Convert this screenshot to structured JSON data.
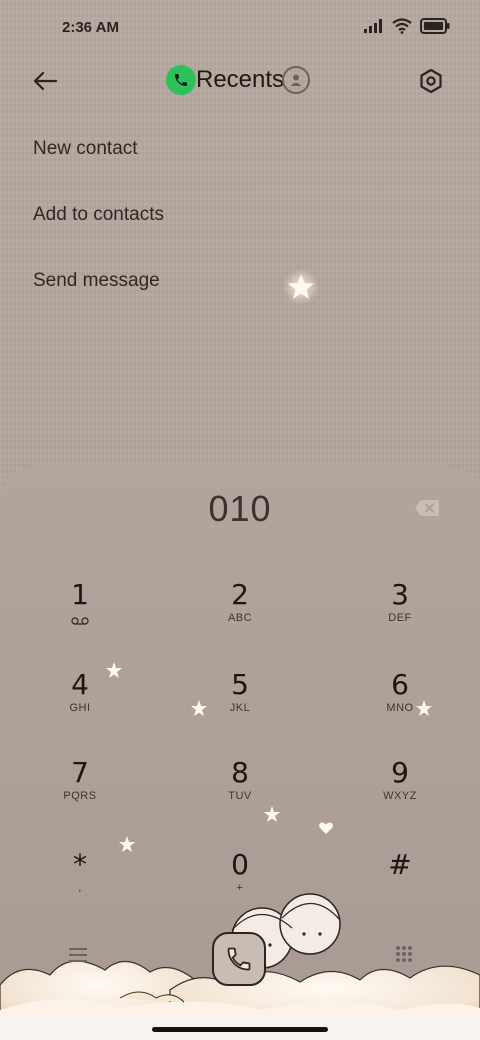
{
  "status": {
    "time": "2:36 AM"
  },
  "header": {
    "title": "Recents"
  },
  "menu": {
    "items": [
      {
        "label": "New contact"
      },
      {
        "label": "Add to contacts"
      },
      {
        "label": "Send message"
      }
    ]
  },
  "dialer": {
    "number": "010",
    "keys": [
      {
        "digit": "1",
        "letters": ""
      },
      {
        "digit": "2",
        "letters": "ABC"
      },
      {
        "digit": "3",
        "letters": "DEF"
      },
      {
        "digit": "4",
        "letters": "GHI"
      },
      {
        "digit": "5",
        "letters": "JKL"
      },
      {
        "digit": "6",
        "letters": "MNO"
      },
      {
        "digit": "7",
        "letters": "PQRS"
      },
      {
        "digit": "8",
        "letters": "TUV"
      },
      {
        "digit": "9",
        "letters": "WXYZ"
      },
      {
        "digit": "*",
        "letters": ","
      },
      {
        "digit": "0",
        "letters": "+"
      },
      {
        "digit": "#",
        "letters": ""
      }
    ]
  },
  "icons": {
    "back": "back-arrow-icon",
    "phone_badge": "phone-icon",
    "contacts": "contacts-icon",
    "settings": "settings-icon",
    "voicemail": "voicemail-icon",
    "backspace": "backspace-icon",
    "call": "call-icon",
    "menu": "menu-icon",
    "keypad": "keypad-icon"
  },
  "colors": {
    "accent_green": "#2cc25a",
    "background": "#b8aaa1",
    "text": "#2d2520"
  }
}
